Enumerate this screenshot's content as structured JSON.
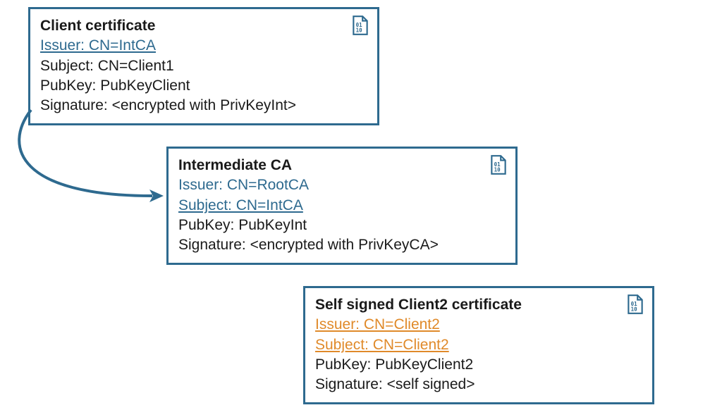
{
  "colors": {
    "border": "#2e6a8f",
    "link_blue": "#2e6a8f",
    "link_orange": "#e08a2a",
    "text": "#1a1a1a"
  },
  "certificates": [
    {
      "title": "Client certificate",
      "issuer": "Issuer: CN=IntCA",
      "subject": "Subject: CN=Client1",
      "pubkey": "PubKey: PubKeyClient",
      "signature": "Signature: <encrypted with PrivKeyInt>"
    },
    {
      "title": "Intermediate CA",
      "issuer": "Issuer: CN=RootCA",
      "subject": "Subject: CN=IntCA",
      "pubkey": "PubKey: PubKeyInt",
      "signature": "Signature: <encrypted with PrivKeyCA>"
    },
    {
      "title": "Self signed Client2 certificate",
      "issuer": "Issuer: CN=Client2",
      "subject": "Subject: CN=Client2",
      "pubkey": "PubKey: PubKeyClient2",
      "signature": "Signature: <self signed>"
    }
  ]
}
